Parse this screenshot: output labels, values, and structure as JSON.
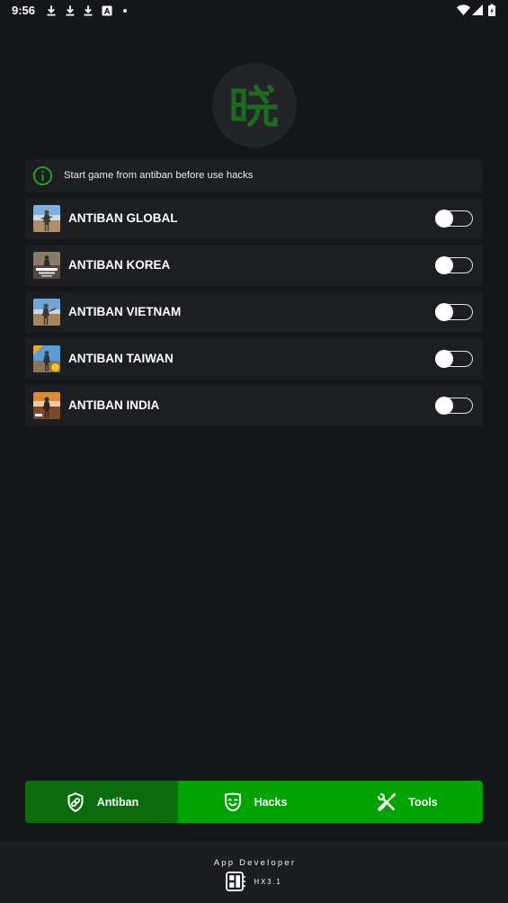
{
  "status_bar": {
    "time": "9:56",
    "notification_icons": [
      "download-icon",
      "download-icon",
      "download-icon",
      "app-a-icon",
      "dot-icon"
    ],
    "system_icons": [
      "wifi-icon",
      "signal-icon",
      "battery-charging-icon"
    ]
  },
  "logo": {
    "text": "晓",
    "icon": "xiao-logo-icon"
  },
  "info": {
    "icon": "info-icon",
    "message": "Start game from antiban before use hacks"
  },
  "antiban_list": [
    {
      "label": "ANTIBAN GLOBAL",
      "icon": "pubg-global-icon",
      "enabled": false
    },
    {
      "label": "ANTIBAN KOREA",
      "icon": "pubg-korea-icon",
      "enabled": false
    },
    {
      "label": "ANTIBAN VIETNAM",
      "icon": "pubg-vietnam-icon",
      "enabled": false
    },
    {
      "label": "ANTIBAN TAIWAN",
      "icon": "pubg-taiwan-icon",
      "enabled": false
    },
    {
      "label": "ANTIBAN INDIA",
      "icon": "pubg-india-icon",
      "enabled": false
    }
  ],
  "bottom_nav": {
    "tabs": [
      {
        "label": "Antiban",
        "icon": "shield-link-icon",
        "selected": true
      },
      {
        "label": "Hacks",
        "icon": "mask-icon",
        "selected": false
      },
      {
        "label": "Tools",
        "icon": "tools-icon",
        "selected": false
      }
    ]
  },
  "footer": {
    "title": "App Developer",
    "icon": "developer-board-icon",
    "version": "HX3.1"
  },
  "colors": {
    "background": "#151619",
    "card": "#1d1e21",
    "logo_bg": "#232428",
    "logo_green": "#1d6b1d",
    "info_green": "#1fa81f",
    "accent": "#00a300",
    "accent_selected": "#0b6c0b",
    "footer_bg": "#1c1d20"
  }
}
